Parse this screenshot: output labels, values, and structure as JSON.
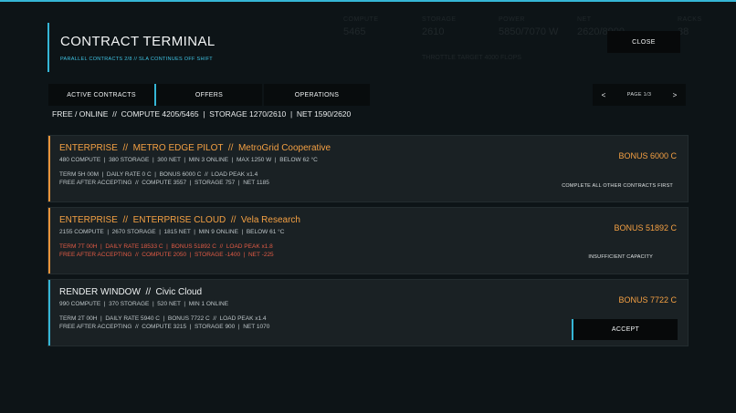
{
  "header": {
    "title": "CONTRACT TERMINAL",
    "subtitle": "PARALLEL CONTRACTS 2/8 // SLA CONTINUES OFF SHIFT",
    "close_label": "CLOSE"
  },
  "background_stats": [
    {
      "label": "COMPUTE",
      "value": "5465"
    },
    {
      "label": "STORAGE",
      "value": "2610"
    },
    {
      "label": "POWER",
      "value": "5850/7070 W"
    },
    {
      "label": "NET",
      "value": "2620/8900"
    },
    {
      "label": "RACKS",
      "value": "38"
    }
  ],
  "background_note": "THROTTLE TARGET 4000 FLOPS",
  "tabs": [
    {
      "label": "ACTIVE CONTRACTS",
      "active": true
    },
    {
      "label": "OFFERS",
      "active": false
    },
    {
      "label": "OPERATIONS",
      "active": false
    }
  ],
  "pager": {
    "prev": "<",
    "label": "PAGE 1/3",
    "next": ">"
  },
  "status_line": "FREE / ONLINE  //  COMPUTE 4205/5465  |  STORAGE 1270/2610  |  NET 1590/2620",
  "contracts": [
    {
      "accent": "orange",
      "title": "ENTERPRISE  //  METRO EDGE PILOT  //  MetroGrid Cooperative",
      "specs": "480 COMPUTE  |  380 STORAGE  |  300 NET  |  MIN 3 ONLINE  |  MAX 1250 W  |  BELOW 62 °C",
      "terms_line1": "TERM 5H 00M  |  DAILY RATE 0 C  |  BONUS 6000 C  //  LOAD PEAK x1.4",
      "terms_line2": "FREE AFTER ACCEPTING  //  COMPUTE 3557  |  STORAGE 757  |  NET 1185",
      "bonus": "BONUS 6000 C",
      "note": "COMPLETE ALL OTHER CONTRACTS FIRST"
    },
    {
      "accent": "orange",
      "title": "ENTERPRISE  //  ENTERPRISE CLOUD  //  Vela Research",
      "specs": "2155 COMPUTE  |  2670 STORAGE  |  1815 NET  |  MIN 9 ONLINE  |  BELOW 61 °C",
      "terms_line1": "TERM 7T 00H  |  DAILY RATE 18533 C  |  BONUS 51892 C  //  LOAD PEAK x1.8",
      "terms_line2": "FREE AFTER ACCEPTING  //  COMPUTE 2050  |  STORAGE -1400  |  NET -225",
      "bonus": "BONUS 51892 C",
      "note": "INSUFFICIENT CAPACITY"
    },
    {
      "accent": "cyan",
      "title": "RENDER WINDOW  //  Civic Cloud",
      "specs": "990 COMPUTE  |  370 STORAGE  |  520 NET  |  MIN 1 ONLINE",
      "terms_line1": "TERM 2T 00H  |  DAILY RATE 5940 C  |  BONUS 7722 C  //  LOAD PEAK x1.4",
      "terms_line2": "FREE AFTER ACCEPTING  //  COMPUTE 3215  |  STORAGE 900  |  NET 1070",
      "bonus": "BONUS 7722 C",
      "accept_label": "ACCEPT"
    }
  ]
}
